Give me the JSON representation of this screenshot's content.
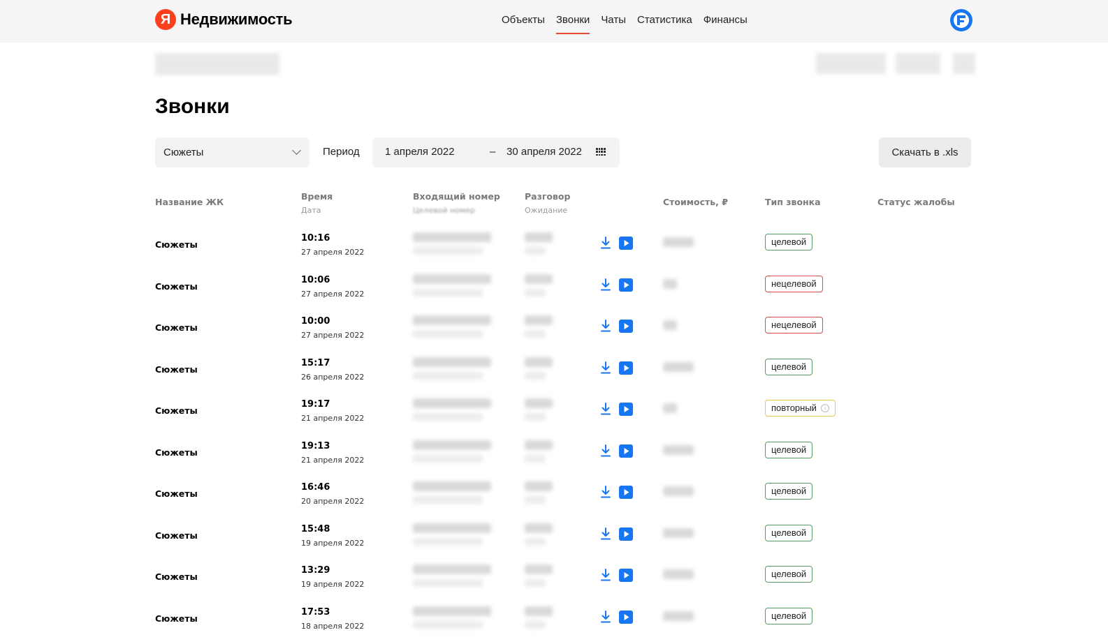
{
  "header": {
    "logo_mark": "Я",
    "logo_text": "Недвижимость",
    "nav": [
      "Объекты",
      "Звонки",
      "Чаты",
      "Статистика",
      "Финансы"
    ],
    "active_nav": "Звонки"
  },
  "page": {
    "title": "Звонки"
  },
  "filters": {
    "project_select": "Сюжеты",
    "period_label": "Период",
    "date_from": "1 апреля 2022",
    "date_dash": "–",
    "date_to": "30 апреля 2022",
    "download_label": "Скачать в .xls"
  },
  "table": {
    "headers": {
      "name": "Название ЖК",
      "time": "Время",
      "time_sub": "Дата",
      "incoming": "Входящий номер",
      "incoming_sub": "Целевой номер",
      "talk": "Разговор",
      "talk_sub": "Ожидание",
      "cost": "Стоимость, ₽",
      "type": "Тип звонка",
      "complaint": "Статус жалобы"
    },
    "rows": [
      {
        "name": "Сюжеты",
        "time": "10:16",
        "date": "27 апреля 2022",
        "type": "целевой",
        "kind": "target"
      },
      {
        "name": "Сюжеты",
        "time": "10:06",
        "date": "27 апреля 2022",
        "type": "нецелевой",
        "kind": "nontarget"
      },
      {
        "name": "Сюжеты",
        "time": "10:00",
        "date": "27 апреля 2022",
        "type": "нецелевой",
        "kind": "nontarget"
      },
      {
        "name": "Сюжеты",
        "time": "15:17",
        "date": "26 апреля 2022",
        "type": "целевой",
        "kind": "target"
      },
      {
        "name": "Сюжеты",
        "time": "19:17",
        "date": "21 апреля 2022",
        "type": "повторный",
        "kind": "repeat"
      },
      {
        "name": "Сюжеты",
        "time": "19:13",
        "date": "21 апреля 2022",
        "type": "целевой",
        "kind": "target"
      },
      {
        "name": "Сюжеты",
        "time": "16:46",
        "date": "20 апреля 2022",
        "type": "целевой",
        "kind": "target"
      },
      {
        "name": "Сюжеты",
        "time": "15:48",
        "date": "19 апреля 2022",
        "type": "целевой",
        "kind": "target"
      },
      {
        "name": "Сюжеты",
        "time": "13:29",
        "date": "19 апреля 2022",
        "type": "целевой",
        "kind": "target"
      },
      {
        "name": "Сюжеты",
        "time": "17:53",
        "date": "18 апреля 2022",
        "type": "целевой",
        "kind": "target"
      }
    ]
  },
  "icons": {
    "download": "download-icon",
    "play": "play-icon",
    "calendar": "calendar-icon",
    "info": "info-icon"
  },
  "colors": {
    "accent_red": "#e54a38",
    "logo_red": "#fc3f1d",
    "link_blue": "#1976f2",
    "target_green": "#5a9a62",
    "nontarget_red": "#d84a4a",
    "repeat_yellow": "#e6c84a"
  }
}
